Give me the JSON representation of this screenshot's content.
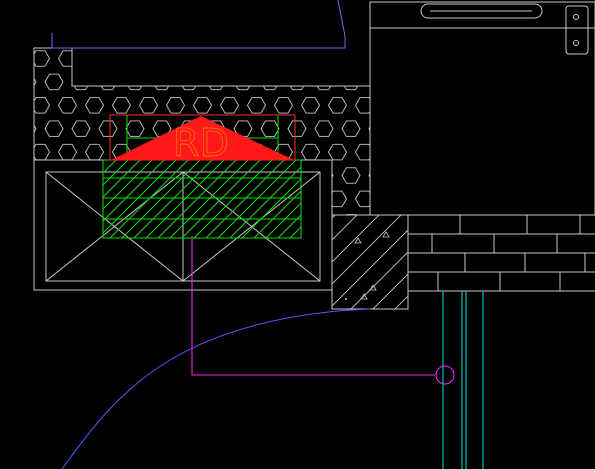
{
  "drawing": {
    "roof_drain_tag": "RD",
    "colors": {
      "background": "#000000",
      "outline": "#c8c8c8",
      "roof_edge": "#6a6aff",
      "drain_marker": "#ff1a1a",
      "drain_box": "#ff2a2a",
      "hatch": "#00e000",
      "pipe": "#ff22ff",
      "column": "#00e6e6",
      "curve": "#4a5cff"
    }
  }
}
